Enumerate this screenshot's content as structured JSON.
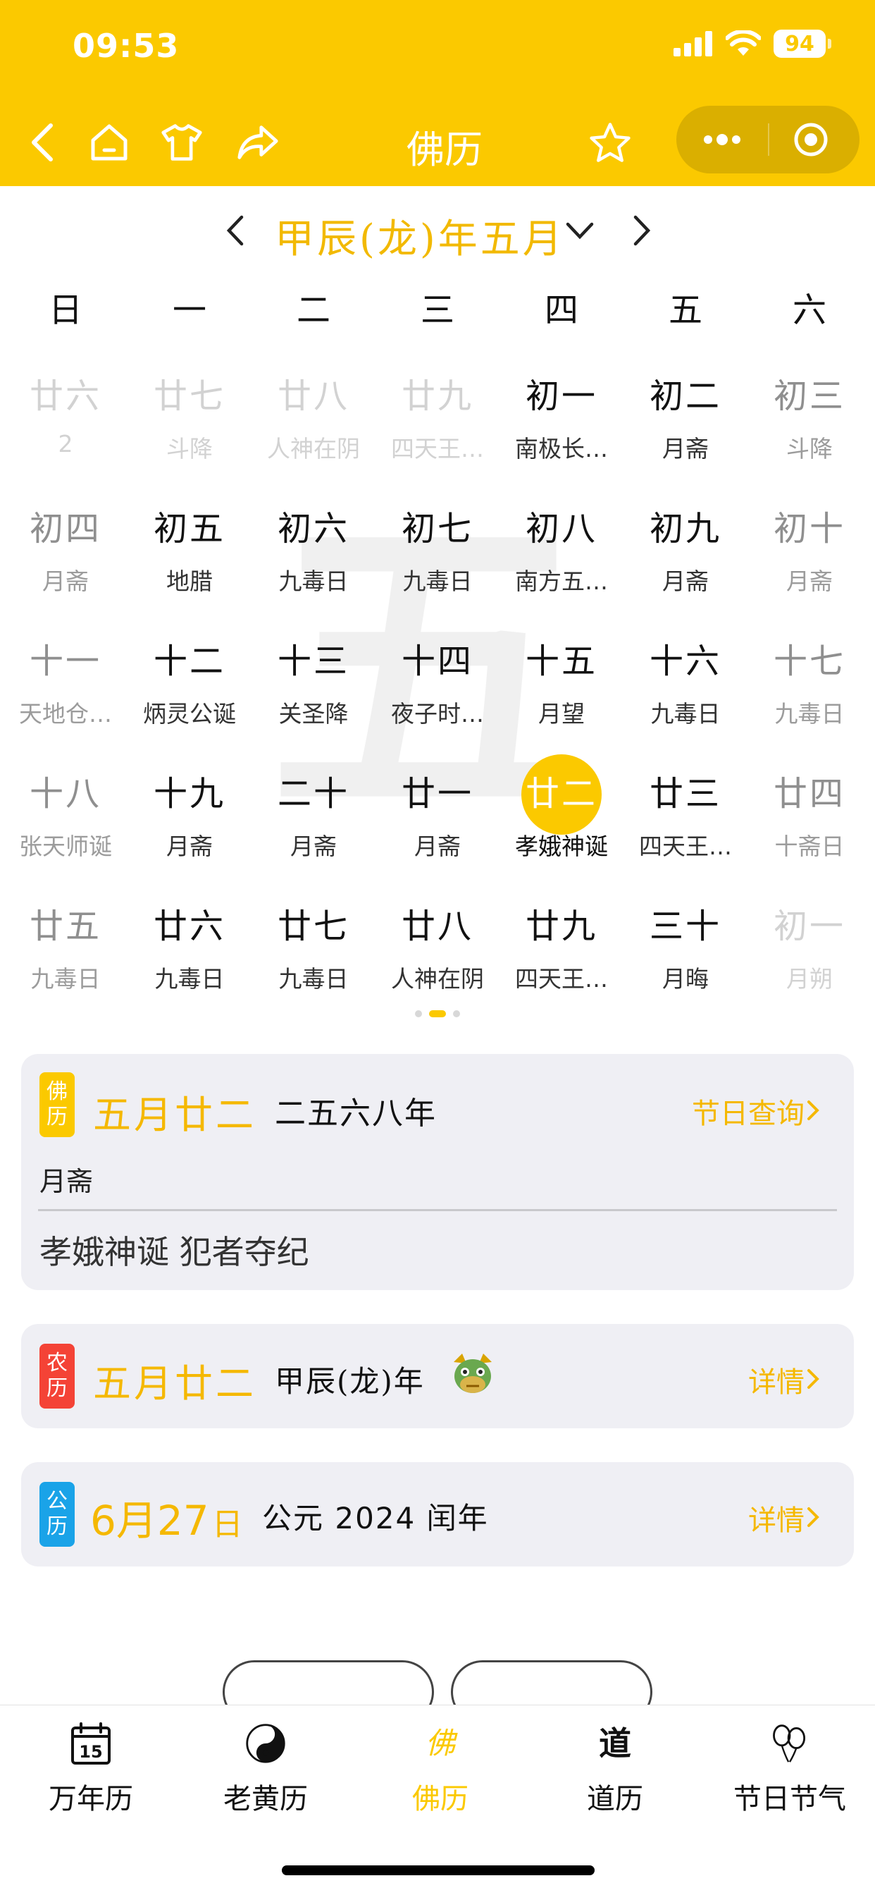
{
  "status_bar": {
    "time": "09:53",
    "battery": "94"
  },
  "nav": {
    "title": "佛历"
  },
  "calendar": {
    "month_title": "甲辰(龙)年五月",
    "watermark": "五",
    "weekdays": [
      "日",
      "一",
      "二",
      "三",
      "四",
      "五",
      "六"
    ],
    "weeks": [
      [
        {
          "lunar": "廿六",
          "fest": "2",
          "kind": "out"
        },
        {
          "lunar": "廿七",
          "fest": "斗降",
          "kind": "out"
        },
        {
          "lunar": "廿八",
          "fest": "人神在阴",
          "kind": "out"
        },
        {
          "lunar": "廿九",
          "fest": "四天王…",
          "kind": "out"
        },
        {
          "lunar": "初一",
          "fest": "南极长…",
          "kind": "in"
        },
        {
          "lunar": "初二",
          "fest": "月斋",
          "kind": "in"
        },
        {
          "lunar": "初三",
          "fest": "斗降",
          "kind": "wkend"
        }
      ],
      [
        {
          "lunar": "初四",
          "fest": "月斋",
          "kind": "wkend"
        },
        {
          "lunar": "初五",
          "fest": "地腊",
          "kind": "in"
        },
        {
          "lunar": "初六",
          "fest": "九毒日",
          "kind": "in"
        },
        {
          "lunar": "初七",
          "fest": "九毒日",
          "kind": "in"
        },
        {
          "lunar": "初八",
          "fest": "南方五…",
          "kind": "in"
        },
        {
          "lunar": "初九",
          "fest": "月斋",
          "kind": "in"
        },
        {
          "lunar": "初十",
          "fest": "月斋",
          "kind": "wkend"
        }
      ],
      [
        {
          "lunar": "十一",
          "fest": "天地仓…",
          "kind": "wkend"
        },
        {
          "lunar": "十二",
          "fest": "炳灵公诞",
          "kind": "in"
        },
        {
          "lunar": "十三",
          "fest": "关圣降",
          "kind": "in"
        },
        {
          "lunar": "十四",
          "fest": "夜子时…",
          "kind": "in"
        },
        {
          "lunar": "十五",
          "fest": "月望",
          "kind": "in"
        },
        {
          "lunar": "十六",
          "fest": "九毒日",
          "kind": "in"
        },
        {
          "lunar": "十七",
          "fest": "九毒日",
          "kind": "wkend"
        }
      ],
      [
        {
          "lunar": "十八",
          "fest": "张天师诞",
          "kind": "wkend"
        },
        {
          "lunar": "十九",
          "fest": "月斋",
          "kind": "in"
        },
        {
          "lunar": "二十",
          "fest": "月斋",
          "kind": "in"
        },
        {
          "lunar": "廿一",
          "fest": "月斋",
          "kind": "in"
        },
        {
          "lunar": "廿二",
          "fest": "孝娥神诞",
          "kind": "sel"
        },
        {
          "lunar": "廿三",
          "fest": "四天王…",
          "kind": "in"
        },
        {
          "lunar": "廿四",
          "fest": "十斋日",
          "kind": "wkend"
        }
      ],
      [
        {
          "lunar": "廿五",
          "fest": "九毒日",
          "kind": "wkend"
        },
        {
          "lunar": "廿六",
          "fest": "九毒日",
          "kind": "in"
        },
        {
          "lunar": "廿七",
          "fest": "九毒日",
          "kind": "in"
        },
        {
          "lunar": "廿八",
          "fest": "人神在阴",
          "kind": "in"
        },
        {
          "lunar": "廿九",
          "fest": "四天王…",
          "kind": "in"
        },
        {
          "lunar": "三十",
          "fest": "月晦",
          "kind": "in"
        },
        {
          "lunar": "初一",
          "fest": "月朔",
          "kind": "out"
        }
      ]
    ]
  },
  "buddhist_card": {
    "badge": [
      "佛",
      "历"
    ],
    "date": "五月廿二",
    "year": "二五六八年",
    "link": "节日查询",
    "line1": "月斋",
    "line2": "孝娥神诞 犯者夺纪"
  },
  "lunar_card": {
    "badge": [
      "农",
      "历"
    ],
    "date": "五月廿二",
    "year": "甲辰(龙)年",
    "link": "详情"
  },
  "solar_card": {
    "badge": [
      "公",
      "历"
    ],
    "date_num": "6月27",
    "date_suffix": "日",
    "year": "公元 2024 闰年",
    "link": "详情"
  },
  "tabs": [
    {
      "label": "万年历",
      "icon": "calendar-15-icon",
      "num": "15"
    },
    {
      "label": "老黄历",
      "icon": "yin-yang-icon"
    },
    {
      "label": "佛历",
      "icon": "fo-char-icon",
      "glyph": "佛",
      "active": true
    },
    {
      "label": "道历",
      "icon": "dao-char-icon",
      "glyph": "道"
    },
    {
      "label": "节日节气",
      "icon": "balloons-icon"
    }
  ],
  "colors": {
    "accent": "#fbc900",
    "text_accent": "#f5b800",
    "red_badge": "#f44336",
    "blue_badge": "#1aa3e8"
  }
}
